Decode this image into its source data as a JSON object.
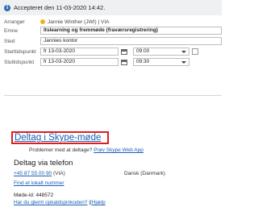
{
  "status": {
    "icon": "info-icon",
    "text": "Accepteret den 11-03-2020 14:42."
  },
  "form": {
    "organizer": {
      "label": "Arrangør",
      "name": "Jannie Winther (JWI) | VIA"
    },
    "subject": {
      "label": "Emne",
      "value": "Itslearning og fremmøde (fraværsregistrering)"
    },
    "location": {
      "label": "Sted",
      "value": "Jannies kontor"
    },
    "start": {
      "label": "Starttidspunkt",
      "date": "fr 13-03-2020",
      "time": "09:00"
    },
    "end": {
      "label": "Sluttidspunkt",
      "date": "fr 13-03-2020",
      "time": "09:30"
    }
  },
  "body": {
    "join_link": "Deltag i Skype-møde",
    "problems_text": "Problemer med at deltage?",
    "problems_link": "Prøv Skype Web App",
    "phone_heading": "Deltag via telefon",
    "phone_number": "+45 87 55 00 90",
    "phone_suffix": "(VIA)",
    "phone_language": "Dansk (Danmark)",
    "find_local": "Find et lokalt nummer",
    "meeting_id": "Møde-id: 448572",
    "forgot_pin": "Har du glemt opkaldspinkoden?",
    "pipe": " |",
    "help": "Hjælp"
  },
  "colors": {
    "link": "#1a5fb4",
    "highlight_border": "#e01e1e",
    "organizer_status": "#f2b01e"
  }
}
